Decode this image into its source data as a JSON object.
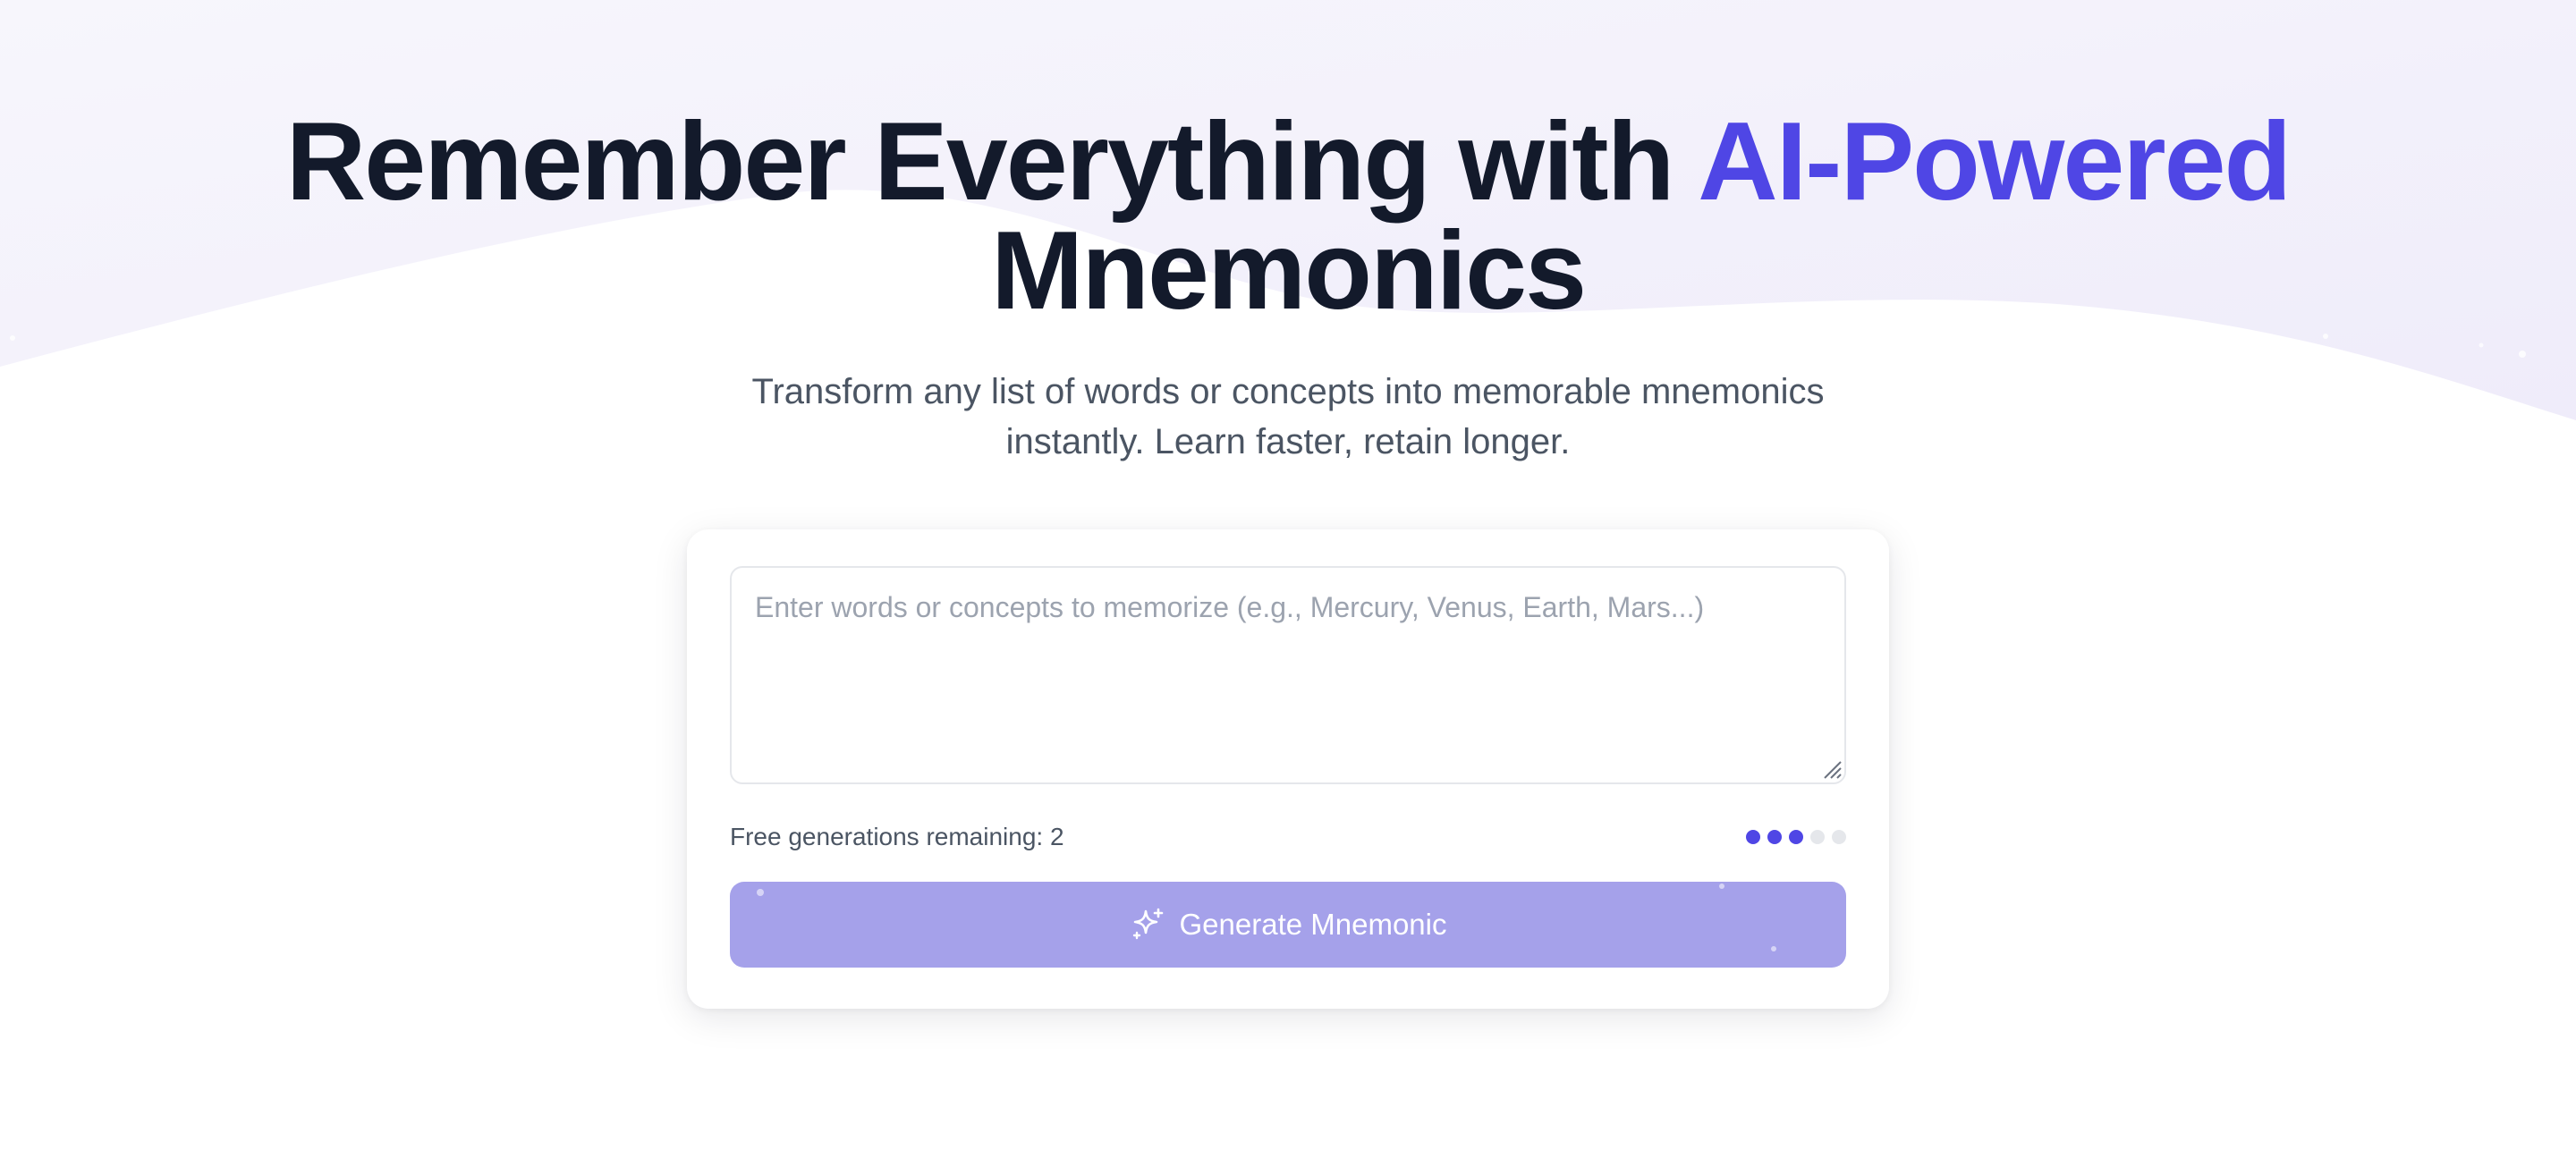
{
  "hero": {
    "title_part1": "Remember Everything with ",
    "title_accent": "AI-Powered",
    "title_part2": "Mnemonics",
    "subtitle_line1": "Transform any list of words or concepts into memorable mnemonics",
    "subtitle_line2": "instantly. Learn faster, retain longer."
  },
  "form": {
    "input_placeholder": "Enter words or concepts to memorize (e.g., Mercury, Venus, Earth, Mars...)",
    "input_value": "",
    "remaining_label": "Free generations remaining: 2",
    "usage_dots": {
      "filled": 3,
      "total": 5
    },
    "generate_label": "Generate Mnemonic",
    "generate_icon": "sparkles-icon"
  },
  "colors": {
    "accent": "#4f46e5",
    "title": "#131a2b",
    "button_bg": "#a5a1ea",
    "background_tint": "#f1effb"
  }
}
